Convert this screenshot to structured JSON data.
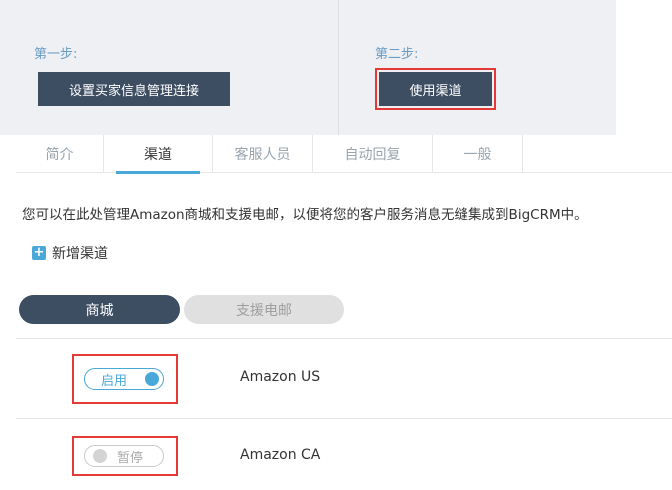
{
  "steps": [
    {
      "label": "第一步:",
      "button": "设置买家信息管理连接"
    },
    {
      "label": "第二步:",
      "button": "使用渠道"
    }
  ],
  "tabs": [
    {
      "label": "简介"
    },
    {
      "label": "渠道"
    },
    {
      "label": "客服人员"
    },
    {
      "label": "自动回复"
    },
    {
      "label": "一般"
    }
  ],
  "active_tab": "渠道",
  "description": "您可以在此处管理Amazon商城和支援电邮，以便将您的客户服务消息无缝集成到BigCRM中。",
  "add_channel": {
    "icon": "plus-icon",
    "label": "新增渠道"
  },
  "segments": [
    {
      "label": "商城",
      "selected": true
    },
    {
      "label": "支援电邮",
      "selected": false
    }
  ],
  "channels": [
    {
      "status": "启用",
      "enabled": true,
      "name": "Amazon US"
    },
    {
      "status": "暂停",
      "enabled": false,
      "name": "Amazon CA"
    }
  ],
  "colors": {
    "accent": "#4aa8d8",
    "dark": "#3d4e63",
    "highlight": "#e53935"
  }
}
